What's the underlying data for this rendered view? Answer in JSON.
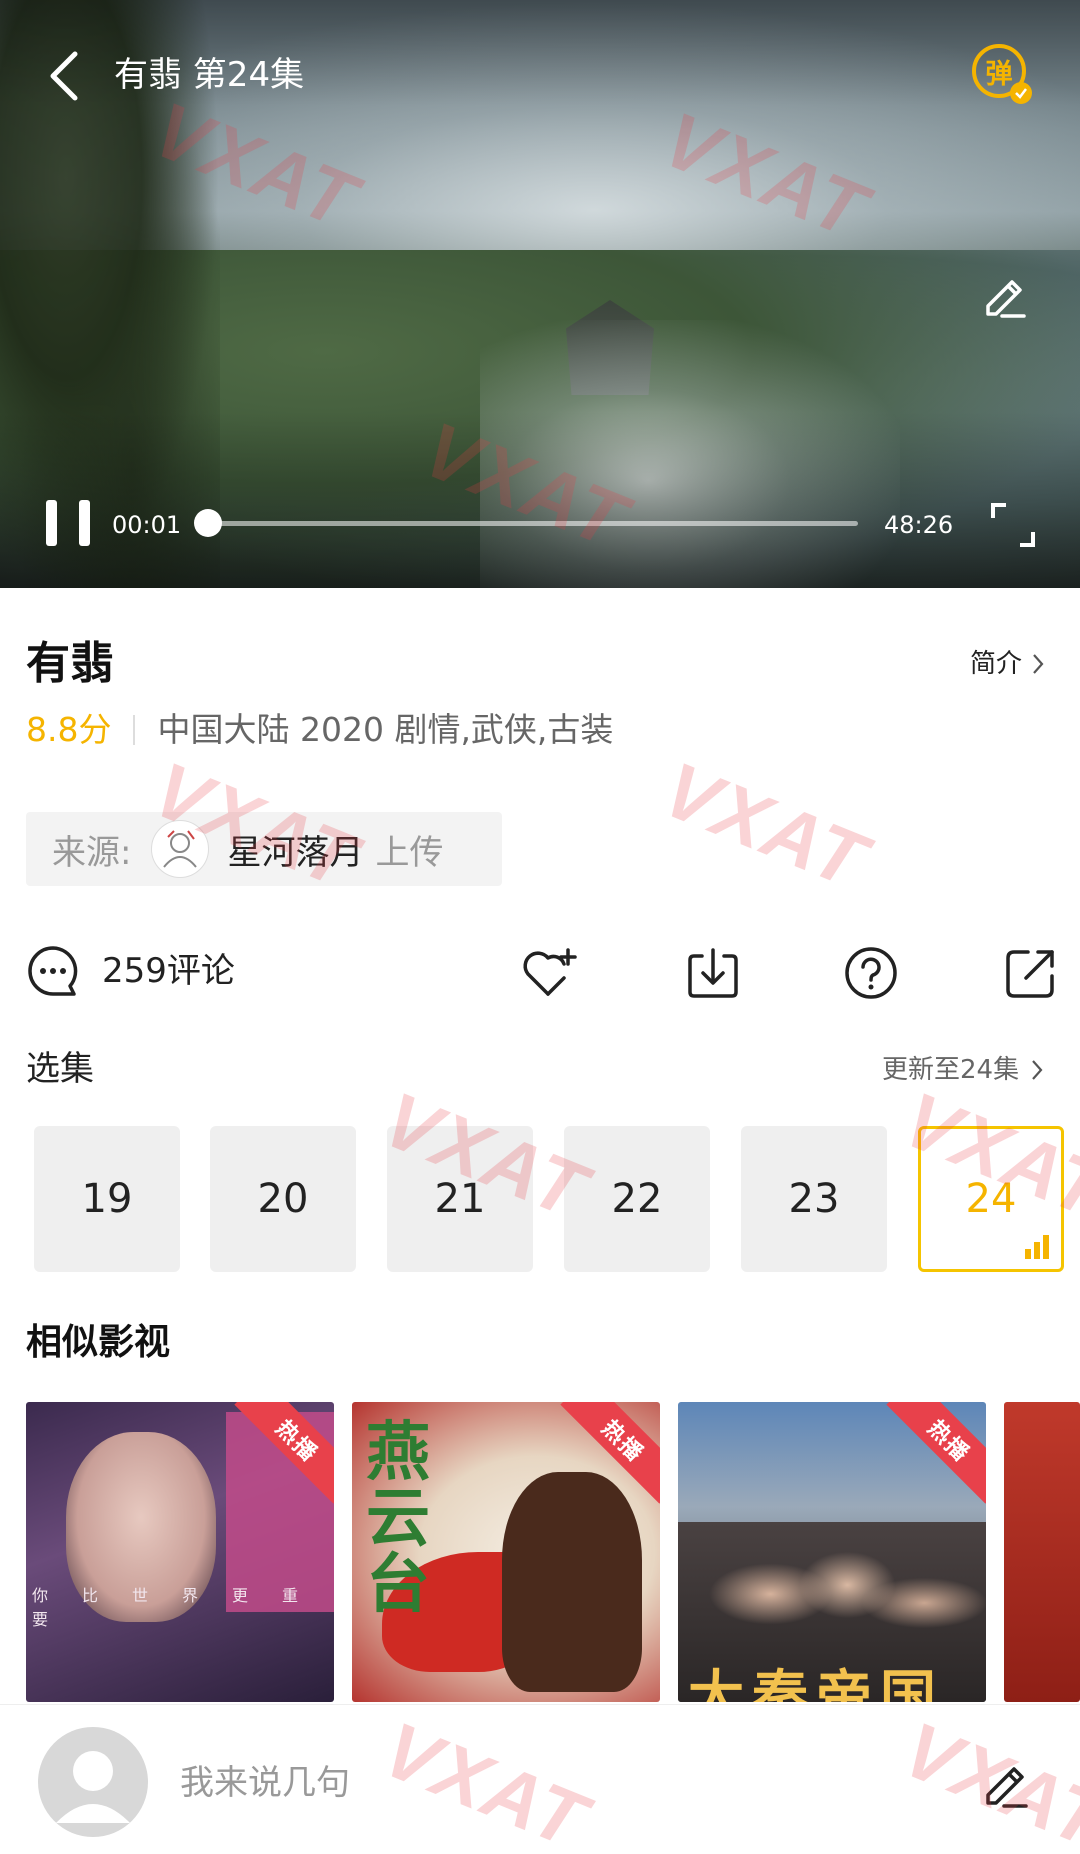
{
  "player": {
    "title": "有翡 第24集",
    "danmaku_label": "弹",
    "time_current": "00:01",
    "time_total": "48:26",
    "progress": 0.0003
  },
  "info": {
    "title": "有翡",
    "intro_label": "简介",
    "rating": "8.8分",
    "meta": "中国大陆  2020  剧情,武侠,古装"
  },
  "source": {
    "label": "来源:",
    "uploader": "星河落月",
    "suffix": "上传"
  },
  "actions": {
    "comment_count": "259评论"
  },
  "episodes": {
    "header": "选集",
    "update_label": "更新至24集",
    "items": [
      "19",
      "20",
      "21",
      "22",
      "23",
      "24"
    ],
    "active": "24"
  },
  "similar": {
    "header": "相似影视",
    "badge": "热播",
    "poster1_tagline": "你比世界更重要",
    "poster2_title": "燕云台",
    "poster3_title": "大秦帝国"
  },
  "bottom": {
    "placeholder": "我来说几句"
  },
  "watermark": "VXAT",
  "colors": {
    "accent": "#f5b400",
    "badge": "#e8414b"
  }
}
